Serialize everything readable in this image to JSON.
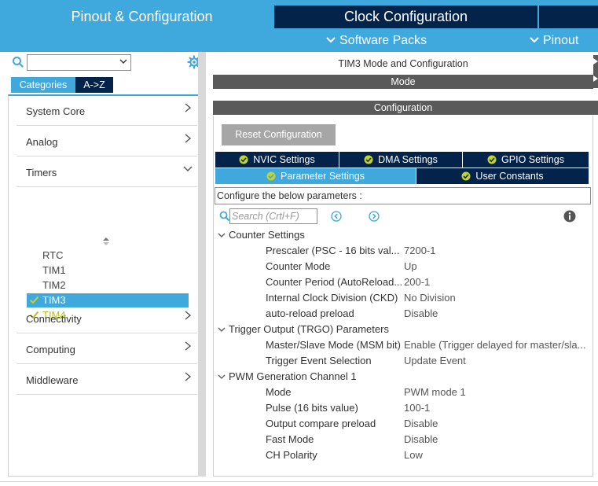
{
  "header": {
    "tab_pinout": "Pinout & Configuration",
    "tab_clock": "Clock Configuration",
    "software_packs": "Software Packs",
    "pinout_menu": "Pinout",
    "accent_color": "#3fa8dc",
    "dark_color": "#03234b"
  },
  "sidebar": {
    "search_value": "",
    "tab_categories": "Categories",
    "tab_az": "A->Z",
    "categories": [
      {
        "label": "System Core",
        "expanded": false
      },
      {
        "label": "Analog",
        "expanded": false
      },
      {
        "label": "Timers",
        "expanded": true
      },
      {
        "label": "Connectivity",
        "expanded": false
      },
      {
        "label": "Computing",
        "expanded": false
      },
      {
        "label": "Middleware",
        "expanded": false
      }
    ],
    "timers": [
      {
        "label": "RTC",
        "checked": false,
        "selected": false
      },
      {
        "label": "TIM1",
        "checked": false,
        "selected": false
      },
      {
        "label": "TIM2",
        "checked": false,
        "selected": false
      },
      {
        "label": "TIM3",
        "checked": true,
        "selected": true
      },
      {
        "label": "TIM4",
        "checked": true,
        "selected": false
      }
    ]
  },
  "main": {
    "title": "TIM3 Mode and Configuration",
    "mode_header": "Mode",
    "config_header": "Configuration",
    "reset_button": "Reset Configuration",
    "settings_tabs": [
      {
        "label": "NVIC Settings",
        "active": false
      },
      {
        "label": "DMA Settings",
        "active": false
      },
      {
        "label": "GPIO Settings",
        "active": false
      },
      {
        "label": "Parameter Settings",
        "active": true
      },
      {
        "label": "User Constants",
        "active": false
      }
    ],
    "params_hint": "Configure the below parameters :",
    "search_placeholder": "Search (Crtl+F)",
    "groups": [
      {
        "label": "Counter Settings",
        "params": [
          {
            "name": "Prescaler (PSC - 16 bits val...",
            "value": "7200-1"
          },
          {
            "name": "Counter Mode",
            "value": "Up"
          },
          {
            "name": "Counter Period (AutoReload...",
            "value": "200-1"
          },
          {
            "name": "Internal Clock Division (CKD)",
            "value": "No Division"
          },
          {
            "name": "auto-reload preload",
            "value": "Disable"
          }
        ]
      },
      {
        "label": "Trigger Output (TRGO) Parameters",
        "params": [
          {
            "name": "Master/Slave Mode (MSM bit)",
            "value": "Enable (Trigger delayed for master/sla..."
          },
          {
            "name": "Trigger Event Selection",
            "value": "Update Event"
          }
        ]
      },
      {
        "label": "PWM Generation Channel 1",
        "params": [
          {
            "name": "Mode",
            "value": "PWM mode 1"
          },
          {
            "name": "Pulse (16 bits value)",
            "value": "100-1"
          },
          {
            "name": "Output compare preload",
            "value": "Disable"
          },
          {
            "name": "Fast Mode",
            "value": "Disable"
          },
          {
            "name": "CH Polarity",
            "value": "Low"
          }
        ]
      }
    ]
  }
}
